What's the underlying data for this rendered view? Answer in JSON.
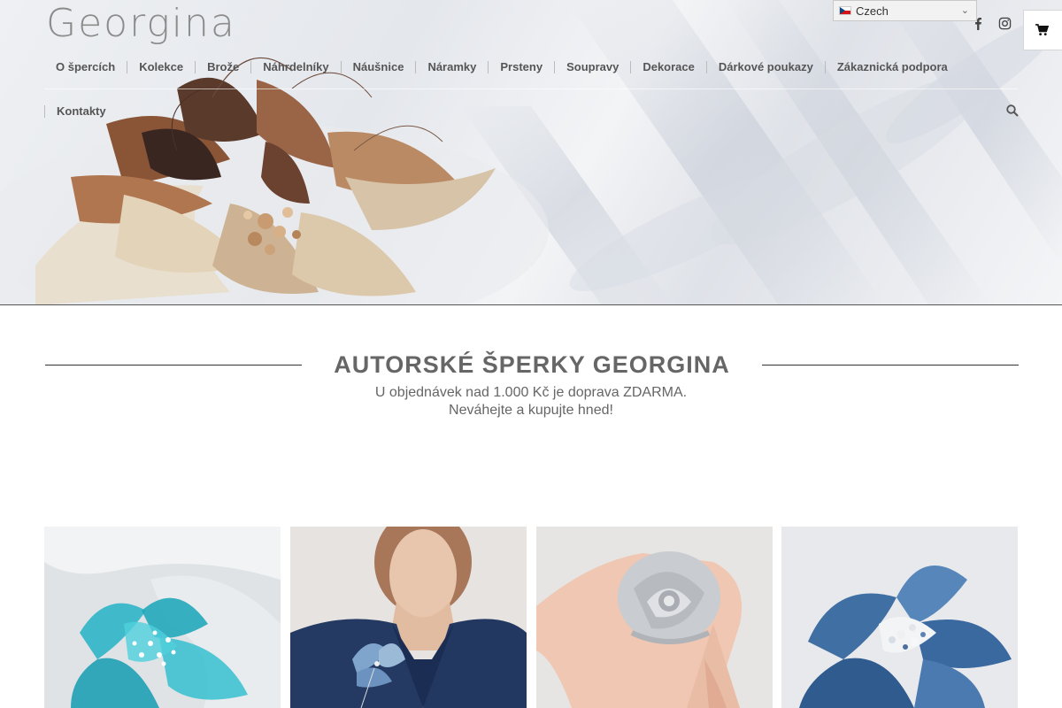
{
  "brand": {
    "logo_text": "Georgina"
  },
  "language": {
    "selected": "Czech",
    "flag_icon": "czech-flag-icon"
  },
  "social": {
    "facebook_icon": "facebook-icon",
    "instagram_icon": "instagram-icon"
  },
  "cart": {
    "icon": "cart-icon"
  },
  "nav": {
    "items": [
      "O špercích",
      "Kolekce",
      "Brože",
      "Náhrdelníky",
      "Náušnice",
      "Náramky",
      "Prsteny",
      "Soupravy",
      "Dekorace",
      "Dárkové poukazy",
      "Zákaznická podpora"
    ],
    "second_row": [
      "Kontakty"
    ],
    "search_icon": "search-icon"
  },
  "main": {
    "title": "AUTORSKÉ ŠPERKY GEORGINA",
    "subtitle_line1": "U objednávek nad 1.000 Kč je doprava ZDARMA.",
    "subtitle_line2": "Neváhejte a kupujte hned!"
  },
  "colors": {
    "accent_text": "#555555",
    "heading": "#666666"
  }
}
